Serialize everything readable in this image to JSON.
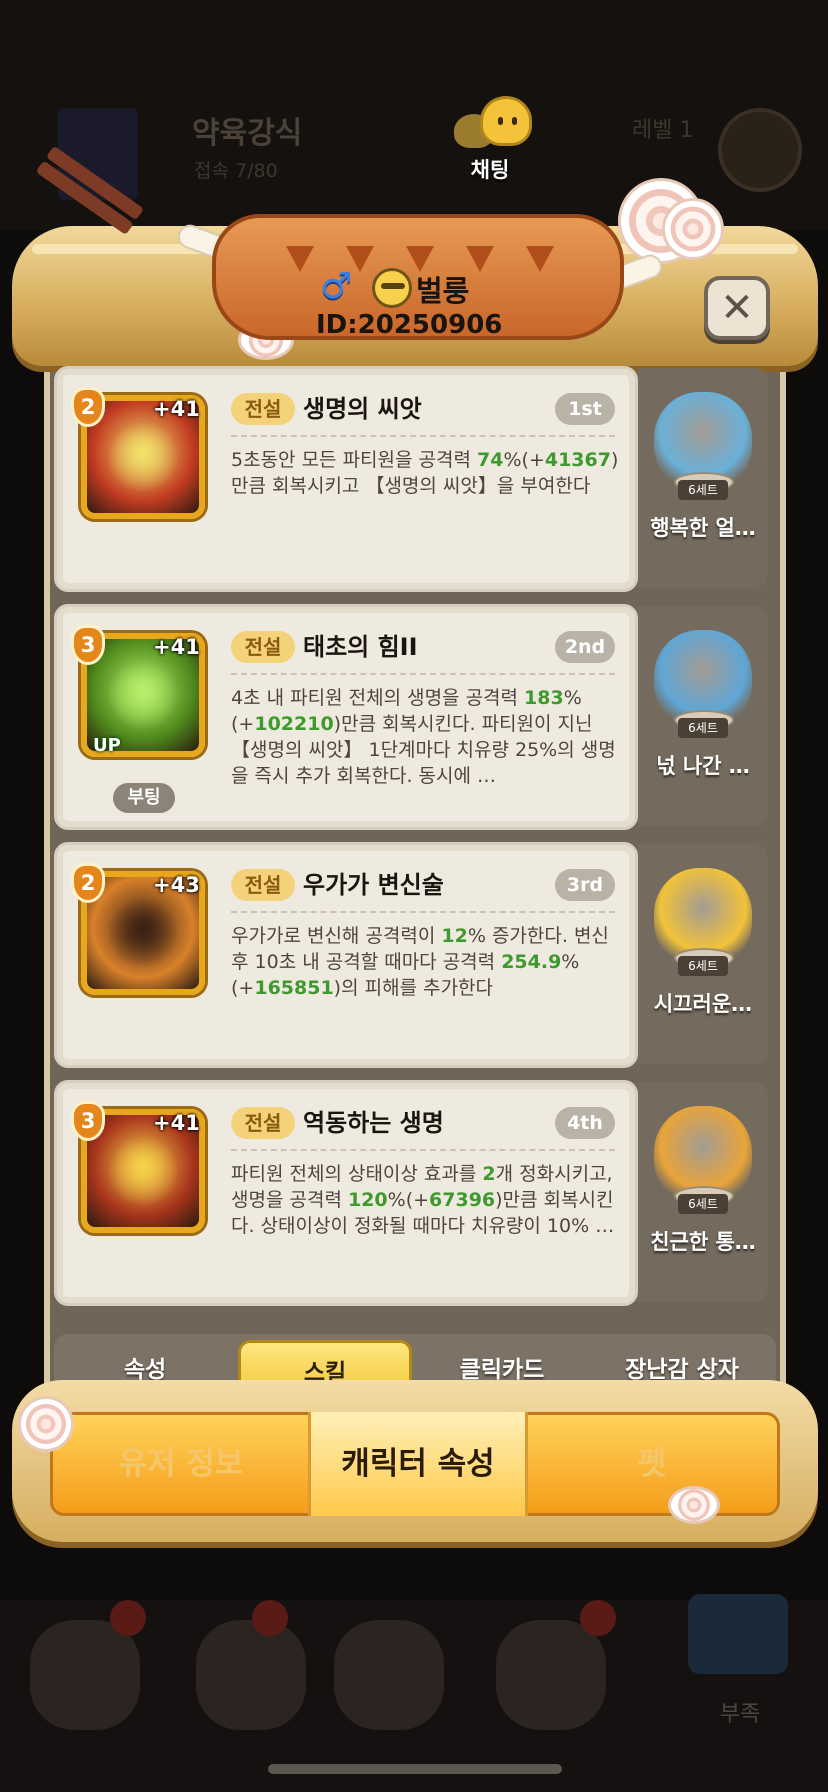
{
  "background": {
    "clan_name": "약육강식",
    "clan_sub": "접속 7/80",
    "level_text": "레벨 1",
    "chat_label": "채팅",
    "tribe_label": "부족"
  },
  "profile": {
    "gender_symbol": "♂",
    "name": "벌룽",
    "id": "ID:20250906"
  },
  "close_symbol": "✕",
  "skills": [
    {
      "rank": "2",
      "plus": "+41",
      "grade": "전설",
      "name": "생명의 씨앗",
      "slot": "1st",
      "desc_parts": [
        "5초동안 모든 파티원을 공격력 ",
        "74",
        "%(+",
        "41367",
        ")만큼 회복시키고 【생명의 씨앗】을 부여한다"
      ],
      "icon_color": "#c23b22",
      "glow_color": "#f1e36a"
    },
    {
      "rank": "3",
      "plus": "+41",
      "up_label": "UP",
      "boost_label": "부팅",
      "grade": "전설",
      "name": "태초의 힘II",
      "slot": "2nd",
      "desc_parts": [
        "4초 내 파티원 전체의 생명을 공격력 ",
        "183",
        "%(+",
        "102210",
        ")만큼 회복시킨다. 파티원이 지닌 【생명의 씨앗】 1단계마다 치유량 25%의 생명을 즉시 추가 회복한다. 동시에 …"
      ],
      "icon_color": "#4f8a1c",
      "glow_color": "#b7f06a"
    },
    {
      "rank": "2",
      "plus": "+43",
      "grade": "전설",
      "name": "우가가 변신술",
      "slot": "3rd",
      "desc_parts": [
        "우가가로 변신해 공격력이 ",
        "12",
        "% 증가한다. 변신 후 10초 내 공격할 때마다 공격력 ",
        "254.9",
        "%(+",
        "165851",
        ")의 피해를 추가한다"
      ],
      "icon_color": "#d8812a",
      "glow_color": "#3a2014"
    },
    {
      "rank": "3",
      "plus": "+41",
      "grade": "전설",
      "name": "역동하는 생명",
      "slot": "4th",
      "desc_parts": [
        "파티원 전체의 상태이상 효과를 ",
        "2",
        "개 정화시키고, 생명을 공격력 ",
        "120",
        "%(+",
        "67396",
        ")만큼 회복시킨다. 상태이상이 정화될 때마다 치유량이 10% …"
      ],
      "icon_color": "#a8341c",
      "glow_color": "#f7d24a"
    }
  ],
  "sets": [
    {
      "tag": "6세트",
      "name": "행복한 얼…",
      "color": "#6ab0d8"
    },
    {
      "tag": "6세트",
      "name": "넋 나간 …",
      "color": "#5fa6d6"
    },
    {
      "tag": "6세트",
      "name": "시끄러운…",
      "color": "#f2c23a"
    },
    {
      "tag": "6세트",
      "name": "친근한 통…",
      "color": "#e9a43a"
    }
  ],
  "sub_tabs": [
    {
      "label": "속성",
      "active": false
    },
    {
      "label": "스킬",
      "active": true
    },
    {
      "label": "클릭카드",
      "active": false
    },
    {
      "label": "장난감 상자",
      "active": false
    }
  ],
  "main_tabs": [
    {
      "label": "유저 정보",
      "active": false
    },
    {
      "label": "캐릭터 속성",
      "active": true
    },
    {
      "label": "펫",
      "active": false
    }
  ],
  "colors": {
    "accent_green": "#3e9a2e",
    "tab_active": "#f1c634",
    "panel": "#6f6658"
  }
}
